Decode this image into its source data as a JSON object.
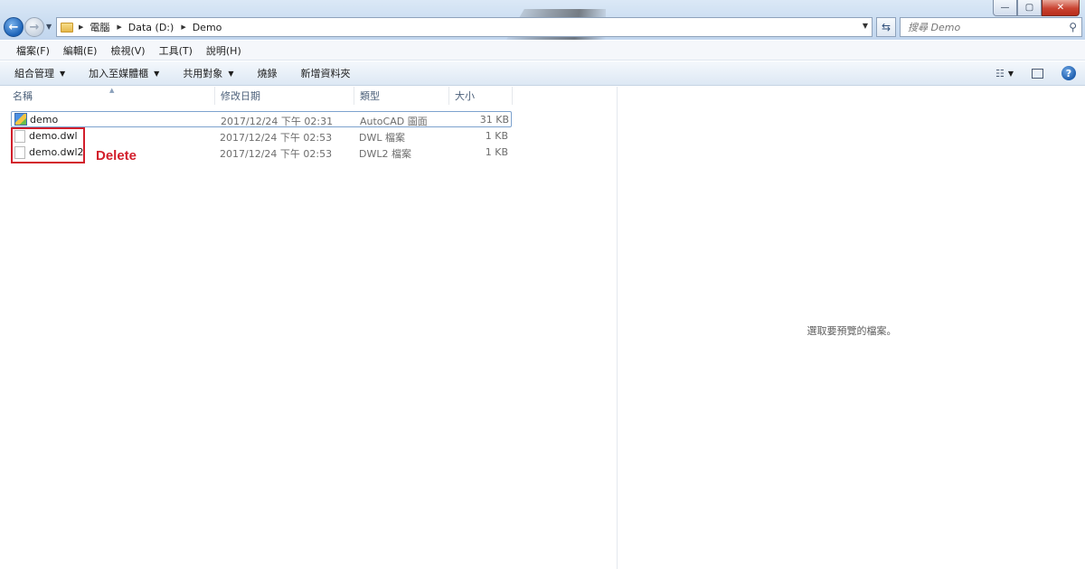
{
  "window": {
    "minimize_glyph": "—",
    "maximize_glyph": "▢",
    "close_glyph": "✕"
  },
  "nav": {
    "back_icon": "arrow-left",
    "forward_icon": "arrow-right"
  },
  "address": {
    "breadcrumbs": [
      "電腦",
      "Data (D:)",
      "Demo"
    ]
  },
  "search": {
    "placeholder": "搜尋 Demo"
  },
  "menu": {
    "items": [
      "檔案(F)",
      "編輯(E)",
      "檢視(V)",
      "工具(T)",
      "說明(H)"
    ]
  },
  "toolbar": {
    "organize": "組合管理",
    "add_to_library": "加入至媒體櫃",
    "share_with": "共用對象",
    "burn": "燒錄",
    "new_folder": "新增資料夾"
  },
  "columns": {
    "name": "名稱",
    "date": "修改日期",
    "type": "類型",
    "size": "大小"
  },
  "files": [
    {
      "name": "demo",
      "date": "2017/12/24 下午 02:31",
      "type": "AutoCAD 圖面",
      "size": "31 KB",
      "icon": "autocad-drawing-icon"
    },
    {
      "name": "demo.dwl",
      "date": "2017/12/24 下午 02:53",
      "type": "DWL 檔案",
      "size": "1 KB",
      "icon": "blank-file-icon"
    },
    {
      "name": "demo.dwl2",
      "date": "2017/12/24 下午 02:53",
      "type": "DWL2 檔案",
      "size": "1 KB",
      "icon": "blank-file-icon"
    }
  ],
  "annotation": {
    "label": "Delete",
    "color": "#d21e2b"
  },
  "preview": {
    "message": "選取要預覽的檔案。"
  }
}
